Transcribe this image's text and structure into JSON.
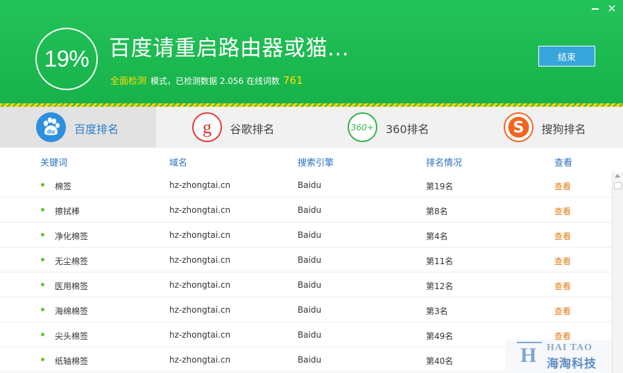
{
  "window": {
    "minimize_glyph": "",
    "close_glyph": "×"
  },
  "header": {
    "progress": "19%",
    "title": "百度请重启路由器或猫...",
    "mode_highlight": "全面检测",
    "status_text": "模式，已检测数据 2.056 在线词数",
    "online_count": "761",
    "end_button": "结束",
    "colors": {
      "bg": "#1eb952",
      "highlight": "#ffde00",
      "button": "#36a6dc"
    }
  },
  "tabs": [
    {
      "label": "百度排名",
      "icon": "baidu-paw-icon",
      "active": true
    },
    {
      "label": "谷歌排名",
      "icon": "google-g-icon",
      "active": false
    },
    {
      "label": "360排名",
      "icon": "360-icon",
      "active": false
    },
    {
      "label": "搜狗排名",
      "icon": "sogou-s-icon",
      "active": false
    }
  ],
  "table": {
    "columns": [
      "关键词",
      "域名",
      "搜索引擎",
      "排名情况",
      "查看"
    ],
    "rows": [
      {
        "keyword": "棉签",
        "domain": "hz-zhongtai.cn",
        "engine": "Baidu",
        "rank": "第19名",
        "action": "查看"
      },
      {
        "keyword": "擦拭棒",
        "domain": "hz-zhongtai.cn",
        "engine": "Baidu",
        "rank": "第8名",
        "action": "查看"
      },
      {
        "keyword": "净化棉签",
        "domain": "hz-zhongtai.cn",
        "engine": "Baidu",
        "rank": "第4名",
        "action": "查看"
      },
      {
        "keyword": "无尘棉签",
        "domain": "hz-zhongtai.cn",
        "engine": "Baidu",
        "rank": "第11名",
        "action": "查看"
      },
      {
        "keyword": "医用棉签",
        "domain": "hz-zhongtai.cn",
        "engine": "Baidu",
        "rank": "第12名",
        "action": "查看"
      },
      {
        "keyword": "海绵棉签",
        "domain": "hz-zhongtai.cn",
        "engine": "Baidu",
        "rank": "第3名",
        "action": "查看"
      },
      {
        "keyword": "尖头棉签",
        "domain": "hz-zhongtai.cn",
        "engine": "Baidu",
        "rank": "第49名",
        "action": "查看"
      },
      {
        "keyword": "纸轴棉签",
        "domain": "hz-zhongtai.cn",
        "engine": "Baidu",
        "rank": "第40名",
        "action": "查看"
      }
    ]
  },
  "watermark": {
    "brand_en": "HAI TAO",
    "brand_cn": "海淘科技",
    "logo_letter": "H"
  }
}
